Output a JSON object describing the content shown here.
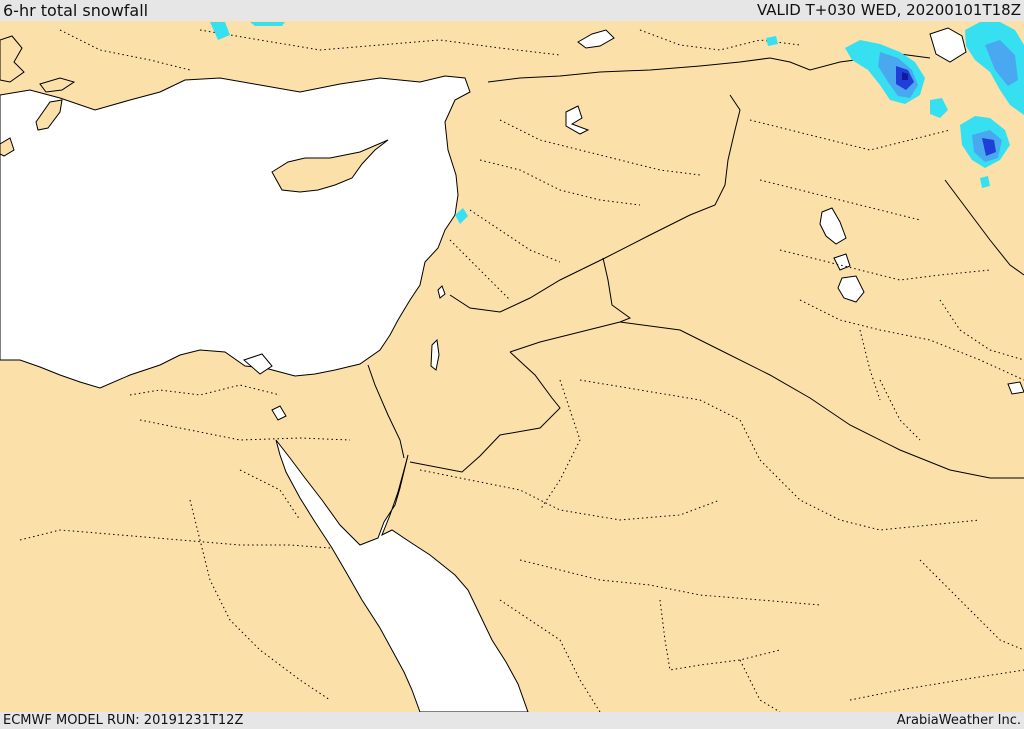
{
  "header": {
    "title": "6-hr total snowfall",
    "valid": "VALID T+030 WED, 20200101T18Z"
  },
  "footer": {
    "model_run": "ECMWF MODEL RUN: 20191231T12Z",
    "credit": "ArabiaWeather Inc."
  },
  "colors": {
    "land": "#fce0aa",
    "water": "#ffffff",
    "border": "#000000",
    "snow_light": "#36e0f0",
    "snow_moderate": "#4aa8f0",
    "snow_heavy": "#1f3fd8",
    "snow_extreme": "#101a9a"
  }
}
